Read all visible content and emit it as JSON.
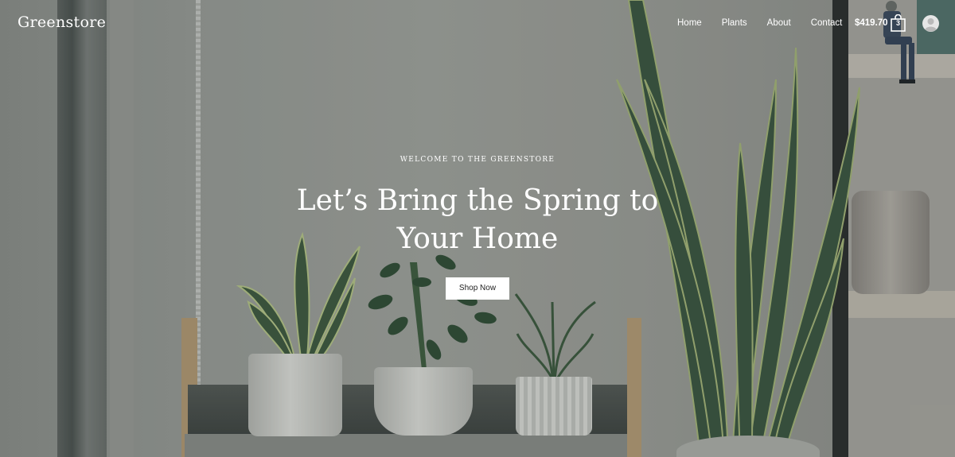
{
  "header": {
    "logo": "Greenstore",
    "nav": [
      {
        "label": "Home"
      },
      {
        "label": "Plants"
      },
      {
        "label": "About"
      },
      {
        "label": "Contact"
      }
    ],
    "cart_total": "$419.70",
    "cart_count": "3",
    "icons": {
      "cart": "shopping-bag-icon",
      "user": "user-avatar-icon"
    }
  },
  "hero": {
    "eyebrow": "WELCOME TO THE GREENSTORE",
    "headline": "Let’s Bring the Spring to Your Home",
    "cta_label": "Shop Now"
  },
  "colors": {
    "text": "#ffffff",
    "button_bg": "#ffffff",
    "button_text": "#222222",
    "leaf_dark": "#2f4a36",
    "leaf_light": "#8fa86a"
  }
}
